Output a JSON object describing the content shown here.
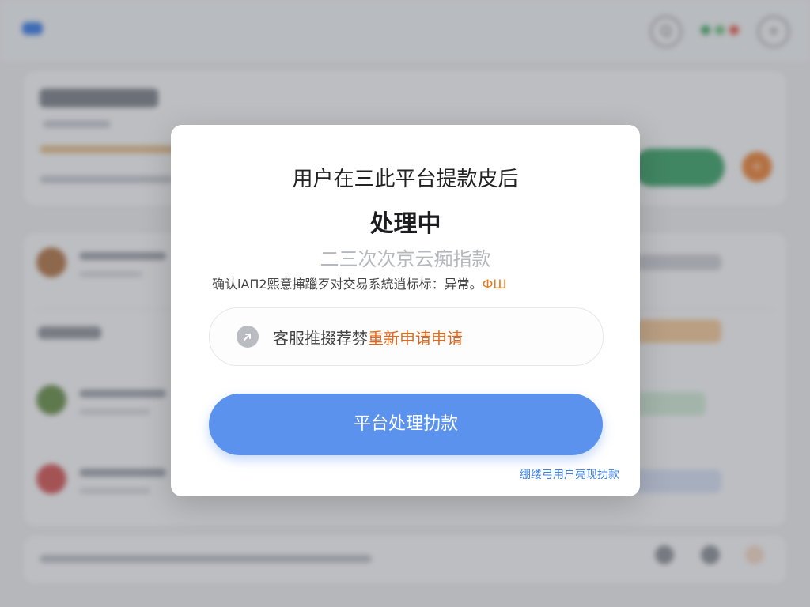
{
  "background": {
    "header": {
      "search_left": "Q",
      "search_right": "+"
    },
    "orange_badge_label": "+"
  },
  "modal": {
    "title": "用户在三此平台提款皮后",
    "status": "处理中",
    "subtitle": "二三次次京云痴指款",
    "notice_text": "确认iAП2熙意撺躐歹对交易系統逍标标：异常。",
    "notice_badge": "ФШ",
    "support": {
      "icon": "arrow-icon",
      "prefix": "客服推掇荐棼",
      "link": "重新申请申请"
    },
    "primary_button": "平台处理扐款",
    "bottom_link": "绷缕弓用户亮现扐款"
  },
  "colors": {
    "primary": "#5a92ee",
    "accent_orange": "#e2671b",
    "link_blue": "#3f7fe0",
    "green": "#3fa26b"
  }
}
